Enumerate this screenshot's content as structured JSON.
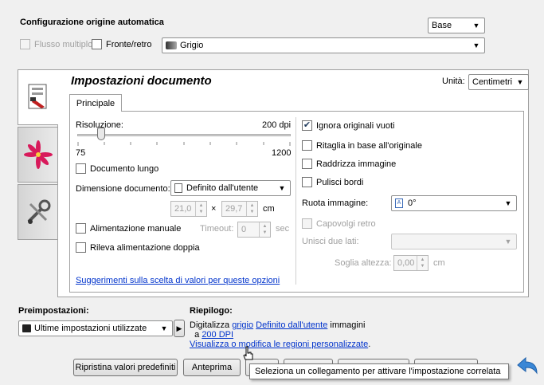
{
  "top": {
    "title": "Configurazione origine automatica",
    "mode": "Base",
    "multi_feed": "Flusso multiplo",
    "duplex": "Fronte/retro",
    "color_mode": "Grigio"
  },
  "panel": {
    "title": "Impostazioni documento",
    "units_label": "Unità:",
    "units_value": "Centimetri",
    "tab": "Principale"
  },
  "left": {
    "resolution_label": "Risoluzione:",
    "resolution_value": "200 dpi",
    "resolution_level": 200,
    "slider_min": "75",
    "slider_max": "1200",
    "long_document": "Documento lungo",
    "doc_size_label": "Dimensione documento:",
    "doc_size_value": "Definito dall'utente",
    "width": "21,0",
    "times": "×",
    "height": "29,7",
    "size_unit": "cm",
    "manual_feed": "Alimentazione manuale",
    "timeout_label": "Timeout:",
    "timeout_value": "0",
    "timeout_unit": "sec",
    "double_feed": "Rileva alimentazione doppia",
    "hint_link": "Suggerimenti sulla scelta di valori per queste opzioni"
  },
  "right": {
    "ignore_blank": "Ignora originali vuoti",
    "crop": "Ritaglia in base all'originale",
    "straighten": "Raddrizza immagine",
    "clean_edges": "Pulisci bordi",
    "rotate_label": "Ruota immagine:",
    "rotate_value": "0°",
    "flip_back": "Capovolgi retro",
    "merge_label": "Unisci due lati:",
    "merge_value": "",
    "threshold_label": "Soglia altezza:",
    "threshold_value": "0,00",
    "threshold_unit": "cm"
  },
  "bottom": {
    "presets_label": "Preimpostazioni:",
    "presets_value": "Ultime impostazioni utilizzate",
    "summary_label": "Riepilogo:",
    "summary_prefix": "Digitalizza",
    "summary_link_color": "grigio",
    "summary_link_size": "Definito dall'utente",
    "summary_suffix": "immagini",
    "summary_a": "a",
    "summary_link_dpi": "200 DPI",
    "summary_link_regions": "Visualizza o modifica le regioni personalizzate",
    "summary_end": ".",
    "reset_button": "Ripristina valori predefiniti",
    "preview_button": "Anteprima",
    "tooltip": "Seleziona un collegamento per attivare l'impostazione correlata"
  }
}
